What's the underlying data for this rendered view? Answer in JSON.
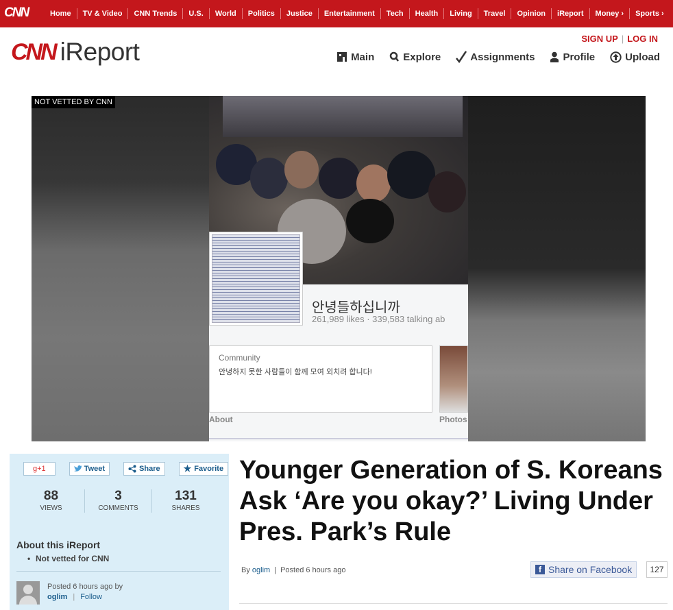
{
  "topnav": {
    "logo": "CNN",
    "items": [
      "Home",
      "TV & Video",
      "CNN Trends",
      "U.S.",
      "World",
      "Politics",
      "Justice",
      "Entertainment",
      "Tech",
      "Health",
      "Living",
      "Travel",
      "Opinion",
      "iReport",
      "Money ›",
      "Sports ›"
    ]
  },
  "header": {
    "brand_cnn": "CNN",
    "brand_ireport": "iReport",
    "signup": "SIGN UP",
    "login": "LOG IN",
    "nav": [
      {
        "label": "Main",
        "icon": "home-icon"
      },
      {
        "label": "Explore",
        "icon": "search-icon"
      },
      {
        "label": "Assignments",
        "icon": "checkmark-icon"
      },
      {
        "label": "Profile",
        "icon": "user-icon"
      },
      {
        "label": "Upload",
        "icon": "upload-icon"
      }
    ]
  },
  "hero": {
    "badge": "NOT VETTED BY CNN",
    "fb_name": "안녕들하십니까",
    "fb_stats": "261,989 likes · 339,583 talking ab",
    "fb_community_title": "Community",
    "fb_community_desc": "안녕하지 못한 사람들이 함께 모여 외치려 합니다!",
    "fb_about": "About",
    "fb_photos": "Photos"
  },
  "sidebar": {
    "gplus": "g+1",
    "tweet": "Tweet",
    "share": "Share",
    "favorite": "Favorite",
    "stats": [
      {
        "value": "88",
        "label": "VIEWS"
      },
      {
        "value": "3",
        "label": "COMMENTS"
      },
      {
        "value": "131",
        "label": "SHARES"
      }
    ],
    "about_title": "About this iReport",
    "about_item": "Not vetted for CNN",
    "posted": "Posted 6 hours ago by",
    "username": "oglim",
    "follow": "Follow"
  },
  "article": {
    "title": "Younger Generation of S. Koreans Ask ‘Are you okay?’ Living Under Pres. Park’s Rule",
    "by_label": "By",
    "author": "oglim",
    "posted": "Posted 6 hours ago",
    "fb_share": "Share on Facebook",
    "fb_count": "127"
  },
  "colors": {
    "cnn_red": "#c4171c",
    "sidebar_bg": "#dbeef8",
    "link_blue": "#1b5d8c",
    "facebook_blue": "#3b5998"
  }
}
